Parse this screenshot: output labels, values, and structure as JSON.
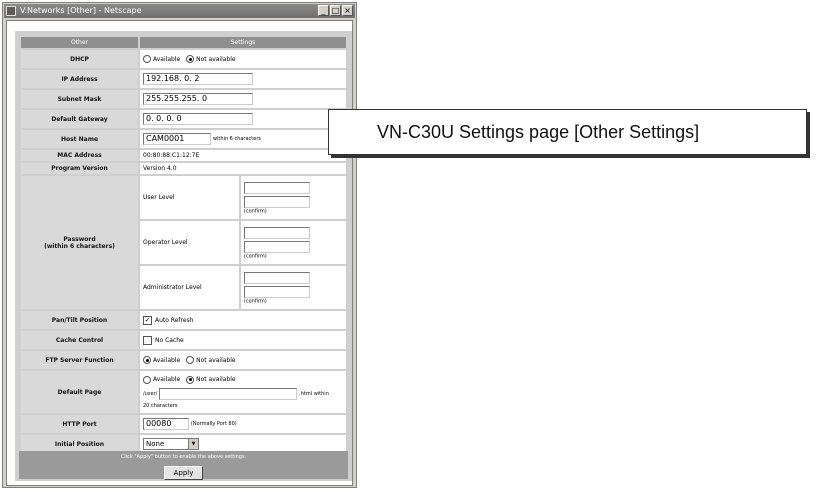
{
  "window": {
    "title": "V.Networks [Other] - Netscape",
    "min": "_",
    "max": "□",
    "close": "×"
  },
  "table": {
    "col_other": "Other",
    "col_settings": "Settings"
  },
  "dhcp": {
    "label": "DHCP",
    "opt_available": "Available",
    "opt_not_available": "Not available",
    "selected": "Not available"
  },
  "ip": {
    "label": "IP Address",
    "value": "192.168.  0.  2"
  },
  "subnet": {
    "label": "Subnet Mask",
    "value": "255.255.255.  0"
  },
  "gateway": {
    "label": "Default Gateway",
    "value": "  0.  0.  0.  0"
  },
  "host": {
    "label": "Host Name",
    "value": "CAM0001",
    "hint": "within 6 characters"
  },
  "mac": {
    "label": "MAC Address",
    "value": "00:80:88:C1:12:7E"
  },
  "program": {
    "label": "Program Version",
    "value": "Version 4.0"
  },
  "password": {
    "label": "Password",
    "sublabel": "(within 6 characters)",
    "user_level": "User Level",
    "operator_level": "Operator Level",
    "admin_level": "Administrator Level",
    "confirm": "(confirm)"
  },
  "pantilt": {
    "label": "Pan/Tilt Position",
    "checkbox_label": "Auto Refresh",
    "checked": true
  },
  "cache": {
    "label": "Cache Control",
    "checkbox_label": "No Cache",
    "checked": false
  },
  "ftp": {
    "label": "FTP Server Function",
    "opt_available": "Available",
    "opt_not_available": "Not available",
    "selected": "Available"
  },
  "default_page": {
    "label": "Default Page",
    "opt_available": "Available",
    "opt_not_available": "Not available",
    "selected": "Not available",
    "path_prefix": "/user/",
    "path_value": "",
    "suffix": ".html within",
    "limit": "20 characters"
  },
  "http": {
    "label": "HTTP Port",
    "value": "00080",
    "hint": "(Normally Port 80)"
  },
  "initial": {
    "label": "Initial Position",
    "selected": "None"
  },
  "footer": {
    "note": "Click \"Apply\" button to enable the above settings.",
    "apply_label": "Apply"
  },
  "caption": "VN-C30U Settings page [Other Settings]"
}
